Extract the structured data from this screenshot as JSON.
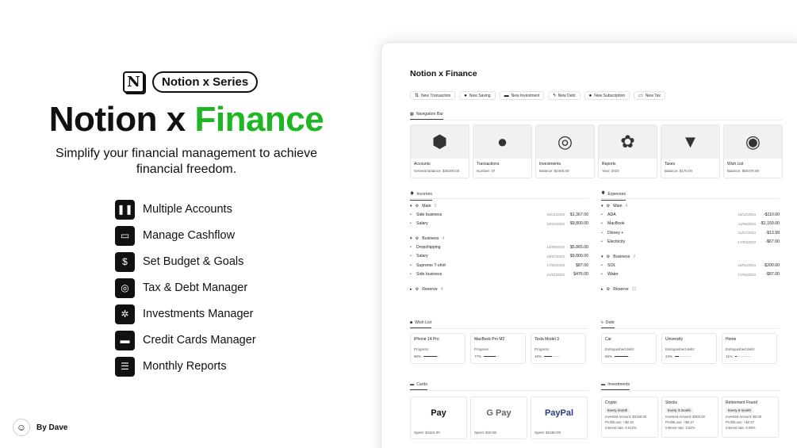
{
  "promo": {
    "logo_letter": "N",
    "series_pill": "Notion x Series",
    "title_prefix": "Notion x",
    "title_accent": "Finance",
    "accent_color": "#1fb624",
    "subtitle": "Simplify your financial management to achieve financial freedom.",
    "features": [
      {
        "icon": "pause-icon",
        "glyph": "❚❚",
        "label": "Multiple Accounts"
      },
      {
        "icon": "wallet-icon",
        "glyph": "▭",
        "label": "Manage Cashflow"
      },
      {
        "icon": "money-bag-icon",
        "glyph": "$",
        "label": "Set Budget & Goals"
      },
      {
        "icon": "target-icon",
        "glyph": "◎",
        "label": "Tax & Debt Manager"
      },
      {
        "icon": "gear-icon",
        "glyph": "✲",
        "label": "Investments Manager"
      },
      {
        "icon": "credit-card-icon",
        "glyph": "▬",
        "label": "Credit Cards Manager"
      },
      {
        "icon": "report-icon",
        "glyph": "☰",
        "label": "Monthly Reports"
      }
    ],
    "byline": "By Dave"
  },
  "app": {
    "title": "Notion x Finance",
    "buttons": [
      {
        "icon": "exchange-icon",
        "glyph": "⇅",
        "label": "New Transaction"
      },
      {
        "icon": "saving-icon",
        "glyph": "●",
        "label": "New Saving"
      },
      {
        "icon": "investment-icon",
        "glyph": "▬",
        "label": "New Investment"
      },
      {
        "icon": "debt-icon",
        "glyph": "ϟ",
        "label": "New Debt"
      },
      {
        "icon": "subscription-icon",
        "glyph": "●",
        "label": "New Subscription"
      },
      {
        "icon": "tax-icon",
        "glyph": "▭",
        "label": "New Tax"
      }
    ],
    "nav_bar": {
      "heading": "Navigation Bar",
      "cards": [
        {
          "image": "cube-icon",
          "glyph": "⬢",
          "title": "Accounts",
          "sub": "General Balance: $26200.00"
        },
        {
          "image": "sphere-icon",
          "glyph": "●",
          "title": "Transactions",
          "sub": "Number: 37"
        },
        {
          "image": "ring-icon",
          "glyph": "◎",
          "title": "Investments",
          "sub": "Balance: $2460.00"
        },
        {
          "image": "flower-icon",
          "glyph": "✿",
          "title": "Reports",
          "sub": "Year: 2023"
        },
        {
          "image": "pyramid-icon",
          "glyph": "▼",
          "title": "Taxes",
          "sub": "Balance: $170.00"
        },
        {
          "image": "torus-icon",
          "glyph": "◉",
          "title": "Wish List",
          "sub": "Balance: $50370.00"
        }
      ]
    },
    "incomes": {
      "heading": "Incomes",
      "groups": [
        {
          "name": "Main",
          "count": "2",
          "rows": [
            {
              "name": "Side business",
              "date": "23/11/2023",
              "amount": "$1,367.00"
            },
            {
              "name": "Salary",
              "date": "19/10/2023",
              "amount": "$9,800.00"
            }
          ]
        },
        {
          "name": "Business",
          "count": "4",
          "rows": [
            {
              "name": "Dropshipping",
              "date": "14/08/2023",
              "amount": "$5,865.00"
            },
            {
              "name": "Salary",
              "date": "19/07/2023",
              "amount": "$9,800.00"
            },
            {
              "name": "Supreme T-shirt",
              "date": "17/02/2023",
              "amount": "$87.00"
            },
            {
              "name": "Side business",
              "date": "21/01/2023",
              "amount": "$476.00"
            }
          ]
        },
        {
          "name": "Reserve",
          "count": "4",
          "rows": []
        }
      ]
    },
    "expenses": {
      "heading": "Expenses",
      "groups": [
        {
          "name": "Main",
          "count": "4",
          "rows": [
            {
              "name": "ADA",
              "date": "16/12/2023",
              "amount": "-$110.00"
            },
            {
              "name": "MacBook",
              "date": "11/08/2023",
              "amount": "-$1,159.00"
            },
            {
              "name": "Disney +",
              "date": "21/07/2023",
              "amount": "-$13.99"
            },
            {
              "name": "Electricity",
              "date": "17/03/2023",
              "amount": "-$67.00"
            }
          ]
        },
        {
          "name": "Business",
          "count": "2",
          "rows": [
            {
              "name": "SOL",
              "date": "10/01/2023",
              "amount": "-$200.00"
            },
            {
              "name": "Water",
              "date": "17/04/2023",
              "amount": "-$87.00"
            }
          ]
        },
        {
          "name": "Reserve",
          "count": "21",
          "rows": []
        }
      ]
    },
    "wish_list": {
      "heading": "Wish List",
      "label": "Progress:",
      "items": [
        {
          "name": "iPhone 14 Pro",
          "value": "86%",
          "pct": 0.86
        },
        {
          "name": "MacBook Pro M2",
          "value": "77%",
          "pct": 0.77
        },
        {
          "name": "Tesla Model 3",
          "value": "48%",
          "pct": 0.48
        }
      ]
    },
    "debt": {
      "heading": "Debt",
      "label": "Extinguished debt:",
      "items": [
        {
          "name": "Car",
          "value": "86%",
          "pct": 0.86
        },
        {
          "name": "University",
          "value": "23%",
          "pct": 0.23
        },
        {
          "name": "Home",
          "value": "11%",
          "pct": 0.11
        }
      ]
    },
    "cards": {
      "heading": "Cards",
      "items": [
        {
          "brand": " Pay",
          "color": "#111",
          "spent": "Spent: $1164.00"
        },
        {
          "brand": "G Pay",
          "color": "#5f6368",
          "spent": "Spent: $10.00"
        },
        {
          "brand": "PayPal",
          "color": "#253b80",
          "spent": "Spent: $2460.00"
        }
      ]
    },
    "investments": {
      "heading": "Investments",
      "items": [
        {
          "name": "Crypto",
          "badge": "Every month",
          "invested": "Invested Amount: $2160.00",
          "pl": "Profit/Loss: +$0.16",
          "rate": "Interest rate: 0.012%"
        },
        {
          "name": "Stocks",
          "badge": "Every 3 month",
          "invested": "Invested Amount: $300.00",
          "pl": "Profit/Loss: +$0.17",
          "rate": "Interest rate: 3.02%"
        },
        {
          "name": "Retirement Found",
          "badge": "Every 6 month",
          "invested": "Invested Amount: $0.00",
          "pl": "Profit/Loss: +$2.37",
          "rate": "Interest rate: 0.09%"
        }
      ]
    }
  }
}
